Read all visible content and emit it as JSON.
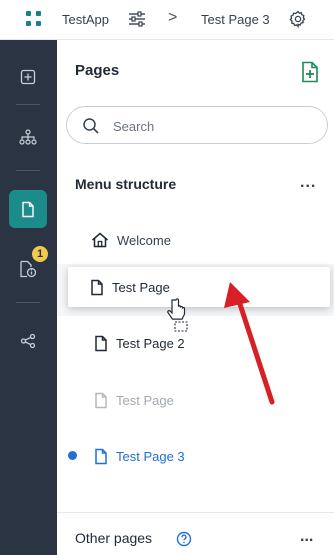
{
  "topbar": {
    "app_name": "TestApp",
    "separator": ">",
    "current_page": "Test Page 3"
  },
  "rail": {
    "notification_count": "1"
  },
  "panel": {
    "title": "Pages",
    "search_placeholder": "Search",
    "menu_structure_title": "Menu structure",
    "more": "...",
    "items": [
      {
        "label": "Welcome",
        "icon": "home-icon"
      },
      {
        "label": "Test Page",
        "icon": "page-icon"
      },
      {
        "label": "Test Page 2",
        "icon": "page-icon"
      },
      {
        "label": "Test Page",
        "icon": "page-icon"
      },
      {
        "label": "Test Page 3",
        "icon": "page-icon"
      }
    ],
    "other_pages_title": "Other pages"
  },
  "colors": {
    "rail_bg": "#2a3442",
    "accent_teal": "#1b8c8a",
    "link_blue": "#1f6fd6",
    "badge_yellow": "#f2c94c",
    "annotation_red": "#d81f26"
  }
}
